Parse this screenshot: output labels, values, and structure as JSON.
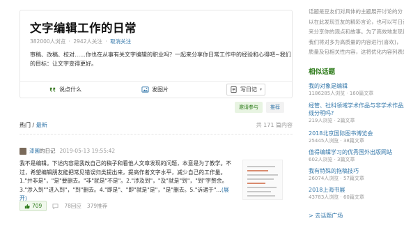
{
  "topic": {
    "title": "文字编辑工作的日常",
    "views": "382000人浏览",
    "followers": "2942人关注",
    "unfollow_label": "取消关注",
    "separator": "·",
    "description": "审稿、改稿、校对……你也在从事有关文字编辑的职业吗？一起来分享你日常工作中的经验和心得吧~我们的目标：让文字变得更好。",
    "actions": [
      {
        "label": "说点什么",
        "icon": "quote-icon"
      },
      {
        "label": "发图片",
        "icon": "image-icon"
      },
      {
        "label": "写日记",
        "icon": "diary-icon",
        "suffix": "▾"
      }
    ]
  },
  "tags": {
    "invite": "邀请参与",
    "recommend": "推荐"
  },
  "sort": {
    "hot": "热门",
    "slash": " / ",
    "latest": "最新",
    "count": "共 171 篇内容"
  },
  "post": {
    "author": "漆園",
    "kind": "的日记",
    "time": "2019-05-13 19:55:42",
    "body": "我不是编辑。下述内容是我改自己的稿子和看他人文章发现的问题，本意是为了教学。不过，希望编辑朋友能把常见错误归类提出来，提高作者文字水平，减少自己的工作量。1.\"并非是\"，\"是\"要删去。\"非\"就是\"不是\"。2.\"涉及到\"，\"及\"就是\"到\"，\"到\"字赘余。3.\"涉入到\"\"进入到\"，\"到\"删去。4.\"即是\"、\"即\"就是\"是\"，\"是\"删去。5.\"诉诸于\"...",
    "expand": "(展开)",
    "likes": "709",
    "replies": "78回应",
    "recommends": "379推荐"
  },
  "sidebar": {
    "intro_lines": [
      "话题是豆友们对具体的主题展开讨论的分",
      "以在此发现豆友的精彩言论，也可以写日记",
      "来分享你的观点和故事。为了高效地发现最",
      "我们将对多为高质量的内容进行(喜欢)，",
      "质量及包相关性内容，这将优化内容列表的"
    ],
    "heading": "相似话题",
    "items": [
      {
        "title": "我的对象是编辑",
        "meta": "1186285人浏览 · 160篇文章"
      },
      {
        "title": "经管、社科领域学术作品与非学术作品之间，",
        "title2": "线分明吗?",
        "meta": "219人浏览 · 2篇文章"
      },
      {
        "title": "2018北京国际图书博览会",
        "meta": "25445人浏览 · 38篇文章"
      },
      {
        "title": "值得编辑学习的优秀国外出版网站",
        "meta": "602人浏览 · 3篇文章"
      },
      {
        "title": "我有特殊的拖稿技巧",
        "meta": "26074人浏览 · 57篇文章"
      },
      {
        "title": "2018上海书展",
        "meta": "43783人浏览 · 60篇文章"
      }
    ],
    "more": "> 去话题广场"
  }
}
